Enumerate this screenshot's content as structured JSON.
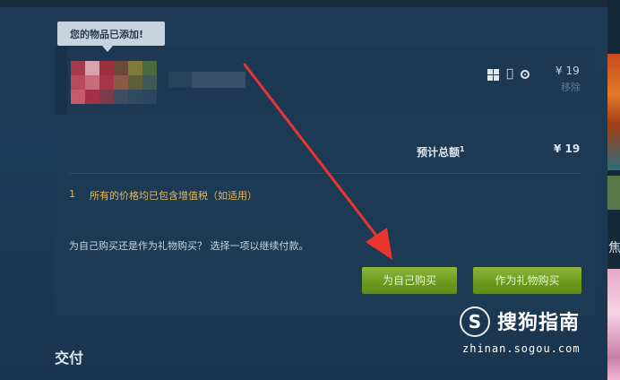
{
  "tooltip": {
    "text": "您的物品已添加!"
  },
  "item": {
    "price": "¥ 19",
    "remove_label": "移除",
    "platforms": [
      "windows-icon",
      "apple-icon",
      "steam-icon"
    ]
  },
  "summary": {
    "total_label": "预计总额",
    "total_footnote_mark": "1",
    "total_price": "¥ 19",
    "footnote_number": "1",
    "footnote_text": "所有的价格均已包含增值税（如适用）",
    "purchase_prompt": "为自己购买还是作为礼物购买？ 选择一项以继续付款。",
    "buy_self_label": "为自己购买",
    "buy_gift_label": "作为礼物购买"
  },
  "delivery": {
    "heading": "交付"
  },
  "side": {
    "heading": "焦"
  },
  "watermark": {
    "logo_char": "S",
    "title": "搜狗指南",
    "url": "zhinan.sogou.com"
  },
  "colors": {
    "button_green": "#6c9a1f",
    "footnote_gold": "#e2b85c",
    "arrow_red": "#e8362f"
  }
}
